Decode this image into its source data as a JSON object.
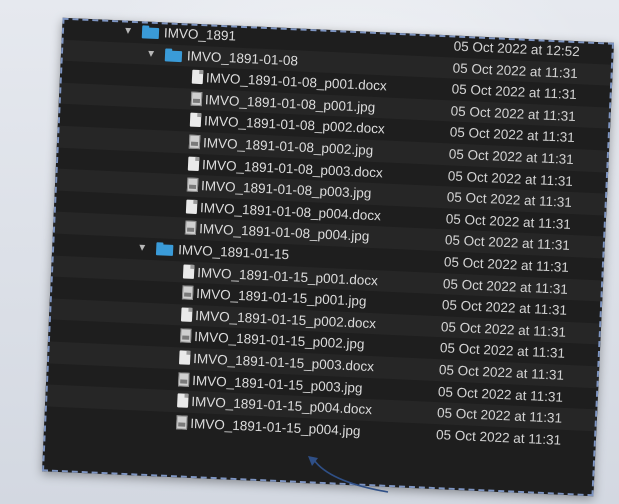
{
  "finder_list": {
    "rows": [
      {
        "type": "folder",
        "level": 0,
        "name": "IMVO_1891",
        "date": "05 Oct 2022 at 12:52"
      },
      {
        "type": "folder",
        "level": 1,
        "name": "IMVO_1891-01-08",
        "date": "05 Oct 2022 at 11:31"
      },
      {
        "type": "docx",
        "level": 2,
        "name": "IMVO_1891-01-08_p001.docx",
        "date": "05 Oct 2022 at 11:31"
      },
      {
        "type": "jpg",
        "level": 2,
        "name": "IMVO_1891-01-08_p001.jpg",
        "date": "05 Oct 2022 at 11:31"
      },
      {
        "type": "docx",
        "level": 2,
        "name": "IMVO_1891-01-08_p002.docx",
        "date": "05 Oct 2022 at 11:31"
      },
      {
        "type": "jpg",
        "level": 2,
        "name": "IMVO_1891-01-08_p002.jpg",
        "date": "05 Oct 2022 at 11:31"
      },
      {
        "type": "docx",
        "level": 2,
        "name": "IMVO_1891-01-08_p003.docx",
        "date": "05 Oct 2022 at 11:31"
      },
      {
        "type": "jpg",
        "level": 2,
        "name": "IMVO_1891-01-08_p003.jpg",
        "date": "05 Oct 2022 at 11:31"
      },
      {
        "type": "docx",
        "level": 2,
        "name": "IMVO_1891-01-08_p004.docx",
        "date": "05 Oct 2022 at 11:31"
      },
      {
        "type": "jpg",
        "level": 2,
        "name": "IMVO_1891-01-08_p004.jpg",
        "date": "05 Oct 2022 at 11:31"
      },
      {
        "type": "folder",
        "level": 1,
        "name": "IMVO_1891-01-15",
        "date": "05 Oct 2022 at 11:31"
      },
      {
        "type": "docx",
        "level": 2,
        "name": "IMVO_1891-01-15_p001.docx",
        "date": "05 Oct 2022 at 11:31"
      },
      {
        "type": "jpg",
        "level": 2,
        "name": "IMVO_1891-01-15_p001.jpg",
        "date": "05 Oct 2022 at 11:31"
      },
      {
        "type": "docx",
        "level": 2,
        "name": "IMVO_1891-01-15_p002.docx",
        "date": "05 Oct 2022 at 11:31"
      },
      {
        "type": "jpg",
        "level": 2,
        "name": "IMVO_1891-01-15_p002.jpg",
        "date": "05 Oct 2022 at 11:31"
      },
      {
        "type": "docx",
        "level": 2,
        "name": "IMVO_1891-01-15_p003.docx",
        "date": "05 Oct 2022 at 11:31"
      },
      {
        "type": "jpg",
        "level": 2,
        "name": "IMVO_1891-01-15_p003.jpg",
        "date": "05 Oct 2022 at 11:31"
      },
      {
        "type": "docx",
        "level": 2,
        "name": "IMVO_1891-01-15_p004.docx",
        "date": "05 Oct 2022 at 11:31"
      },
      {
        "type": "jpg",
        "level": 2,
        "name": "IMVO_1891-01-15_p004.jpg",
        "date": "05 Oct 2022 at 11:31"
      }
    ]
  },
  "colors": {
    "panel_bg": "#1e1e1e",
    "folder": "#3a9bd8",
    "dashed_border": "#7e95c2",
    "arrow": "#2f4f86"
  },
  "icons": {
    "expanded": "disclosure-triangle-down-icon",
    "folder": "folder-icon",
    "docx": "document-icon",
    "jpg": "image-file-icon"
  }
}
